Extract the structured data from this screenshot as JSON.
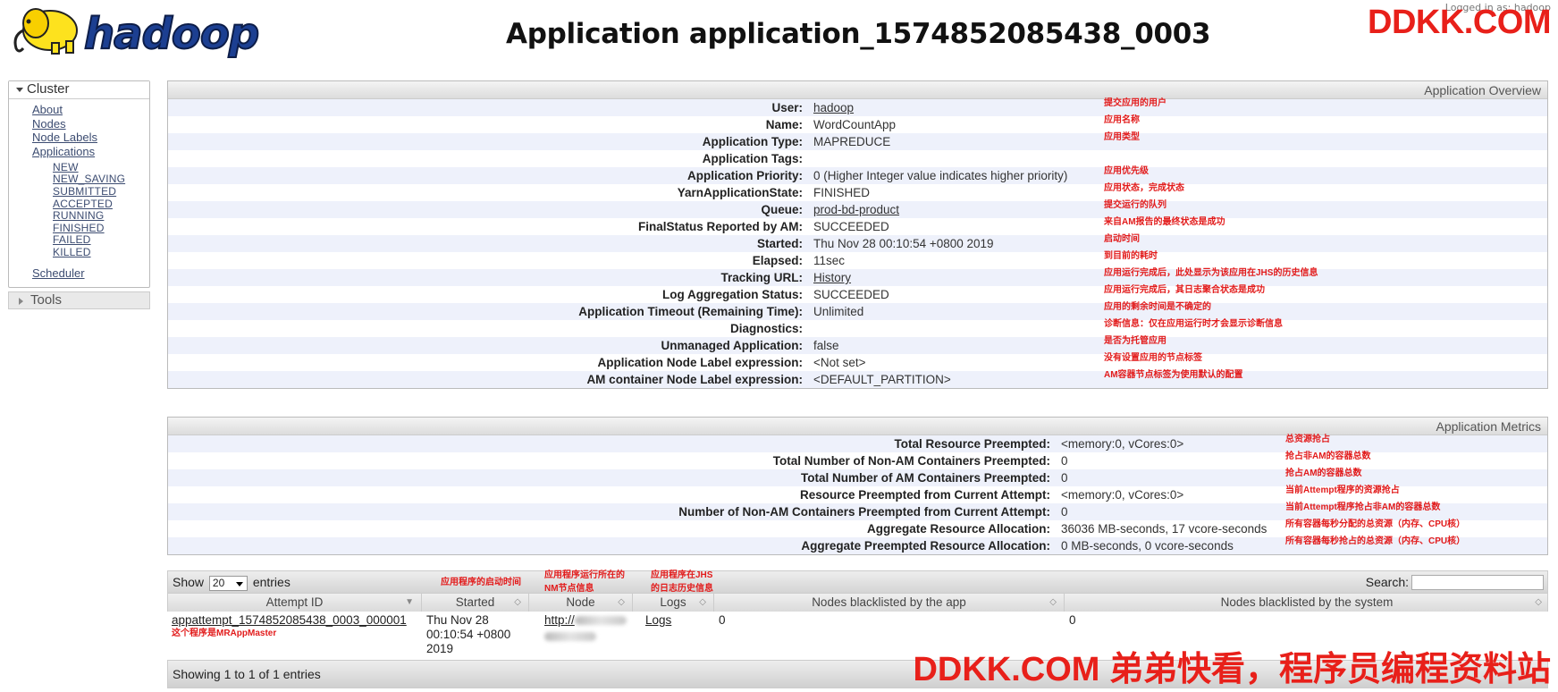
{
  "watermark": {
    "top": "DDKK.COM",
    "bottom": "DDKK.COM 弟弟快看，程序员编程资料站"
  },
  "header": {
    "logo_text": "hadoop",
    "logged_in": "Logged in as: hadoop",
    "title": "Application application_1574852085438_0003"
  },
  "sidebar": {
    "cluster_label": "Cluster",
    "links": [
      "About",
      "Nodes",
      "Node Labels",
      "Applications"
    ],
    "app_states": [
      "NEW",
      "NEW_SAVING",
      "SUBMITTED",
      "ACCEPTED",
      "RUNNING",
      "FINISHED",
      "FAILED",
      "KILLED"
    ],
    "scheduler": "Scheduler",
    "tools_label": "Tools"
  },
  "overview": {
    "header": "Application Overview",
    "rows": [
      {
        "label": "User:",
        "value": "hadoop",
        "note": "提交应用的用户"
      },
      {
        "label": "Name:",
        "value": "WordCountApp",
        "note": "应用名称"
      },
      {
        "label": "Application Type:",
        "value": "MAPREDUCE",
        "note": "应用类型"
      },
      {
        "label": "Application Tags:",
        "value": "",
        "note": ""
      },
      {
        "label": "Application Priority:",
        "value": "0 (Higher Integer value indicates higher priority)",
        "note": "应用优先级"
      },
      {
        "label": "YarnApplicationState:",
        "value": "FINISHED",
        "note": "应用状态，完成状态"
      },
      {
        "label": "Queue:",
        "value": "prod-bd-product",
        "note": "提交运行的队列"
      },
      {
        "label": "FinalStatus Reported by AM:",
        "value": "SUCCEEDED",
        "note": "来自AM报告的最终状态是成功"
      },
      {
        "label": "Started:",
        "value": "Thu Nov 28 00:10:54 +0800 2019",
        "note": "启动时间"
      },
      {
        "label": "Elapsed:",
        "value": "11sec",
        "note": "到目前的耗时"
      },
      {
        "label": "Tracking URL:",
        "value": "History",
        "note": "应用运行完成后，此处显示为该应用在JHS的历史信息"
      },
      {
        "label": "Log Aggregation Status:",
        "value": "SUCCEEDED",
        "note": "应用运行完成后，其日志聚合状态是成功"
      },
      {
        "label": "Application Timeout (Remaining Time):",
        "value": "Unlimited",
        "note": "应用的剩余时间是不确定的"
      },
      {
        "label": "Diagnostics:",
        "value": "",
        "note": "诊断信息：仅在应用运行时才会显示诊断信息"
      },
      {
        "label": "Unmanaged Application:",
        "value": "false",
        "note": "是否为托管应用"
      },
      {
        "label": "Application Node Label expression:",
        "value": "<Not set>",
        "note": "没有设置应用的节点标签"
      },
      {
        "label": "AM container Node Label expression:",
        "value": "<DEFAULT_PARTITION>",
        "note": "AM容器节点标签为使用默认的配置"
      }
    ]
  },
  "metrics": {
    "header": "Application Metrics",
    "rows": [
      {
        "label": "Total Resource Preempted:",
        "value": "<memory:0, vCores:0>",
        "note": "总资源抢占"
      },
      {
        "label": "Total Number of Non-AM Containers Preempted:",
        "value": "0",
        "note": "抢占非AM的容器总数"
      },
      {
        "label": "Total Number of AM Containers Preempted:",
        "value": "0",
        "note": "抢占AM的容器总数"
      },
      {
        "label": "Resource Preempted from Current Attempt:",
        "value": "<memory:0, vCores:0>",
        "note": "当前Attempt程序的资源抢占"
      },
      {
        "label": "Number of Non-AM Containers Preempted from Current Attempt:",
        "value": "0",
        "note": "当前Attempt程序抢占非AM的容器总数"
      },
      {
        "label": "Aggregate Resource Allocation:",
        "value": "36036 MB-seconds, 17 vcore-seconds",
        "note": "所有容器每秒分配的总资源（内存、CPU核）"
      },
      {
        "label": "Aggregate Preempted Resource Allocation:",
        "value": "0 MB-seconds, 0 vcore-seconds",
        "note": "所有容器每秒抢占的总资源（内存、CPU核）"
      }
    ]
  },
  "attempts": {
    "show_label": "Show",
    "page_size": "20",
    "entries_label": "entries",
    "search_label": "Search:",
    "notes": {
      "started": "应用程序的启动时间",
      "node_1": "应用程序运行所在的",
      "node_2": "NM节点信息",
      "logs_1": "应用程序在JHS",
      "logs_2": "的日志历史信息"
    },
    "columns": [
      "Attempt ID",
      "Started",
      "Node",
      "Logs",
      "Nodes blacklisted by the app",
      "Nodes blacklisted by the system"
    ],
    "row": {
      "attempt_id": "appattempt_1574852085438_0003_000001",
      "attempt_note": "这个程序是MRAppMaster",
      "started_1": "Thu Nov 28",
      "started_2": "00:10:54 +0800",
      "started_3": "2019",
      "node_prefix": "http://",
      "logs": "Logs",
      "bl_app": "0",
      "bl_sys": "0"
    },
    "footer": "Showing 1 to 1 of 1 entries"
  },
  "colors": {
    "link": "#3c4c71",
    "note_red": "#e21b1b",
    "logo_blue": "#1c3f91",
    "stripe": "#eef1fb"
  }
}
